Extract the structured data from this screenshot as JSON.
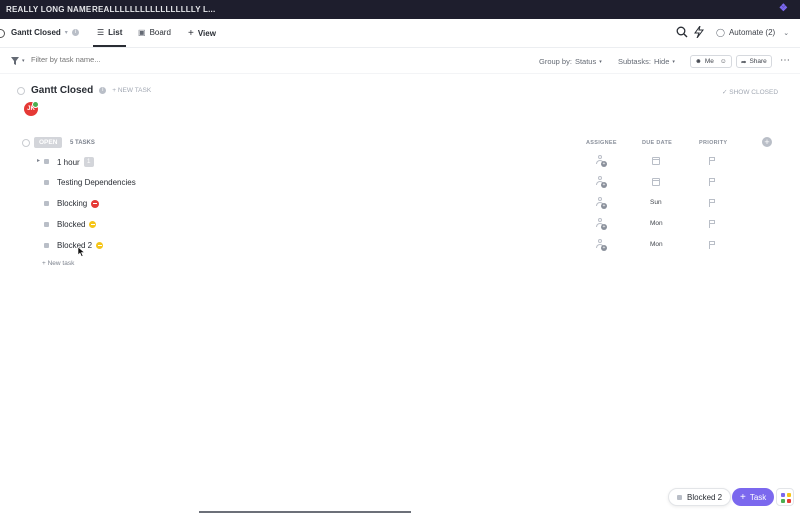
{
  "topbar": {
    "tabs": [
      "REALLY LONG NAME",
      "REALLLLLLLLLLLLLLLLLY L..."
    ]
  },
  "viewbar": {
    "list_name": "Gantt Closed",
    "views": [
      {
        "label": "List",
        "active": true
      },
      {
        "label": "Board",
        "active": false
      }
    ],
    "add_view": "View",
    "automate_label": "Automate (2)"
  },
  "filterbar": {
    "filter_placeholder": "Filter by task name...",
    "group_by_label": "Group by:",
    "group_by_value": "Status",
    "subtasks_label": "Subtasks:",
    "subtasks_value": "Hide",
    "me_label": "Me",
    "share_label": "Share"
  },
  "header": {
    "title": "Gantt Closed",
    "new_task": "+ NEW TASK",
    "show_closed": "SHOW CLOSED",
    "avatar_initials": "JK"
  },
  "group": {
    "status": "OPEN",
    "count": "5 TASKS",
    "columns": [
      "ASSIGNEE",
      "DUE DATE",
      "PRIORITY"
    ]
  },
  "tasks": [
    {
      "name": "1 hour",
      "subtasks": "1",
      "due": "",
      "icon": ""
    },
    {
      "name": "Testing Dependencies",
      "subtasks": "",
      "due": "",
      "icon": ""
    },
    {
      "name": "Blocking",
      "subtasks": "",
      "due": "Sun",
      "icon": "blocking-icon"
    },
    {
      "name": "Blocked",
      "subtasks": "",
      "due": "Mon",
      "icon": "waiting-icon"
    },
    {
      "name": "Blocked 2",
      "subtasks": "",
      "due": "Mon",
      "icon": "waiting-icon"
    }
  ],
  "new_task_row": "+ New task",
  "footer": {
    "tray_item": "Blocked 2",
    "task_button": "Task"
  },
  "colors": {
    "accent": "#7b68ee",
    "blocking": "#e53935",
    "waiting": "#f5c518",
    "status_open": "#d3d5da"
  }
}
